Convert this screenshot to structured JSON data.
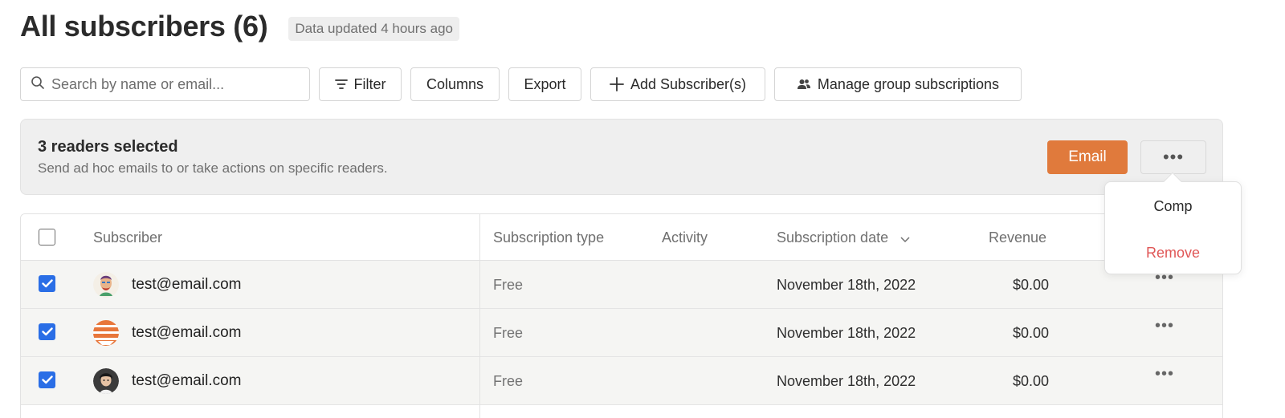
{
  "header": {
    "title": "All subscribers (6)",
    "updated_badge": "Data updated 4 hours ago"
  },
  "toolbar": {
    "search_placeholder": "Search by name or email...",
    "filter_label": "Filter",
    "columns_label": "Columns",
    "export_label": "Export",
    "add_label": "Add Subscriber(s)",
    "manage_label": "Manage group subscriptions"
  },
  "selection": {
    "title": "3 readers selected",
    "subtitle": "Send ad hoc emails to or take actions on specific readers.",
    "email_label": "Email",
    "more_label": "•••"
  },
  "dropdown": {
    "items": [
      {
        "label": "Comp",
        "color": "#2a2a2a"
      },
      {
        "label": "Remove",
        "color": "#e05757"
      }
    ]
  },
  "table": {
    "columns": [
      "Subscriber",
      "Subscription type",
      "Activity",
      "Subscription date",
      "Revenue"
    ],
    "rows": [
      {
        "email": "test@email.com",
        "type": "Free",
        "date": "November 18th, 2022",
        "revenue": "$0.00",
        "more": "•••"
      },
      {
        "email": "test@email.com",
        "type": "Free",
        "date": "November 18th, 2022",
        "revenue": "$0.00",
        "more": "•••"
      },
      {
        "email": "test@email.com",
        "type": "Free",
        "date": "November 18th, 2022",
        "revenue": "$0.00",
        "more": "•••"
      }
    ]
  },
  "colors": {
    "accent": "#e07a3c",
    "checkbox": "#2a6ee6",
    "danger": "#e05757"
  }
}
